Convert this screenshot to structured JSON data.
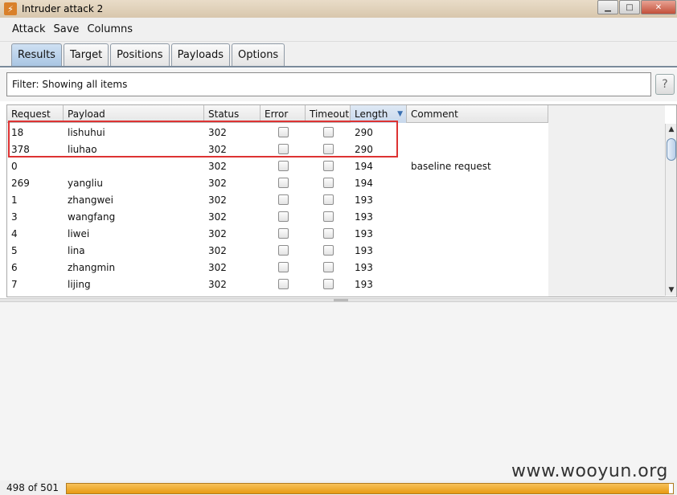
{
  "window": {
    "title": "Intruder attack 2",
    "icon_glyph": "⚡",
    "controls": [
      "minimize",
      "maximize",
      "close"
    ]
  },
  "menu": [
    "Attack",
    "Save",
    "Columns"
  ],
  "tabs": [
    {
      "label": "Results",
      "active": true
    },
    {
      "label": "Target",
      "active": false
    },
    {
      "label": "Positions",
      "active": false
    },
    {
      "label": "Payloads",
      "active": false
    },
    {
      "label": "Options",
      "active": false
    }
  ],
  "filter": {
    "text": "Filter: Showing all items",
    "help_label": "?"
  },
  "table": {
    "columns": [
      "Request",
      "Payload",
      "Status",
      "Error",
      "Timeout",
      "Length",
      "Comment"
    ],
    "sorted_column": "Length",
    "rows": [
      {
        "request": "18",
        "payload": "lishuhui",
        "status": "302",
        "error": false,
        "timeout": false,
        "length": "290",
        "comment": ""
      },
      {
        "request": "378",
        "payload": "liuhao",
        "status": "302",
        "error": false,
        "timeout": false,
        "length": "290",
        "comment": ""
      },
      {
        "request": "0",
        "payload": "",
        "status": "302",
        "error": false,
        "timeout": false,
        "length": "194",
        "comment": "baseline request"
      },
      {
        "request": "269",
        "payload": "yangliu",
        "status": "302",
        "error": false,
        "timeout": false,
        "length": "194",
        "comment": ""
      },
      {
        "request": "1",
        "payload": "zhangwei",
        "status": "302",
        "error": false,
        "timeout": false,
        "length": "193",
        "comment": ""
      },
      {
        "request": "3",
        "payload": "wangfang",
        "status": "302",
        "error": false,
        "timeout": false,
        "length": "193",
        "comment": ""
      },
      {
        "request": "4",
        "payload": "liwei",
        "status": "302",
        "error": false,
        "timeout": false,
        "length": "193",
        "comment": ""
      },
      {
        "request": "5",
        "payload": "lina",
        "status": "302",
        "error": false,
        "timeout": false,
        "length": "193",
        "comment": ""
      },
      {
        "request": "6",
        "payload": "zhangmin",
        "status": "302",
        "error": false,
        "timeout": false,
        "length": "193",
        "comment": ""
      },
      {
        "request": "7",
        "payload": "lijing",
        "status": "302",
        "error": false,
        "timeout": false,
        "length": "193",
        "comment": ""
      }
    ]
  },
  "status": {
    "progress_text": "498 of 501",
    "progress_fraction": 0.994
  },
  "watermark": "www.wooyun.org",
  "colors": {
    "highlight": "#dd3333",
    "progress": "#e79a12",
    "active_tab": "#a9c6e3"
  }
}
